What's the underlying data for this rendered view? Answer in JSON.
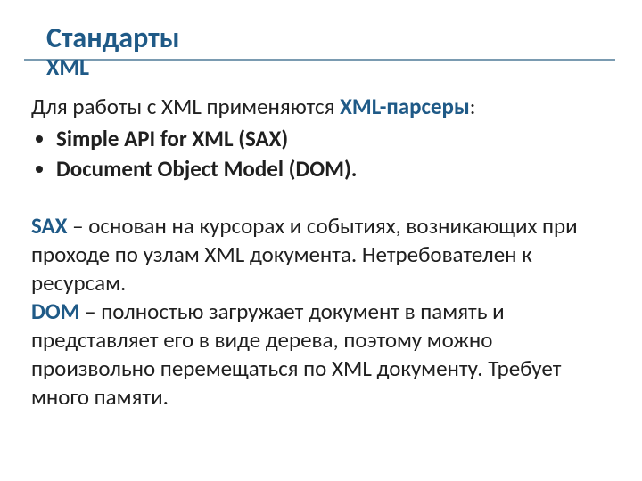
{
  "title": {
    "line1": "Стандарты",
    "line2": "XML"
  },
  "intro": {
    "prefix": "Для работы с XML применяются ",
    "accent": "XML-парсеры",
    "suffix": ":"
  },
  "bullets": {
    "b1": "Simple API for XML (SAX)",
    "b2": "Document Object Model (DOM)."
  },
  "sax": {
    "term": "SAX",
    "text": " – основан на курсорах и событиях, возникающих при проходе по узлам XML документа. Нетребователен к ресурсам."
  },
  "dom": {
    "term": "DOM",
    "text": " – полностью загружает документ в память и представляет его в виде дерева, поэтому можно произвольно перемещаться по XML документу. Требует много памяти."
  }
}
